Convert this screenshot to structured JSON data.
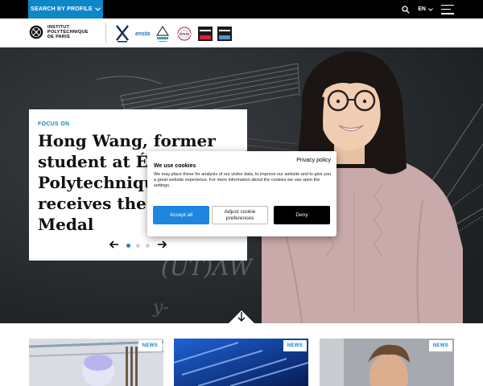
{
  "topbar": {
    "profile_label": "SEARCH BY PROFILE",
    "language": "EN"
  },
  "header": {
    "logo_lines": [
      "INSTITUT",
      "POLYTECHNIQUE",
      "DE PARIS"
    ],
    "partners": [
      "ÉCOLE POLYTECHNIQUE",
      "ENSTA",
      "PONTS",
      "ENSAE",
      "TÉLÉCOM PARIS",
      "TÉLÉCOM SUDPARIS"
    ]
  },
  "hero": {
    "focus_label": "FOCUS ON",
    "headline": "Hong Wang, former student at École Polytechnique, receives the Fields Medal",
    "chalk_text": "(UT)ΛW",
    "chalk_text_2": "y-"
  },
  "cookie": {
    "privacy_link": "Privacy policy",
    "title": "We use cookies",
    "text": "We may place these for analysis of our visitor data, to improve our website and to give you a great website experience. For more information about the cookies we use open the settings.",
    "accept_label": "Accept all",
    "adjust_label": "Adjust cookie preferences",
    "deny_label": "Deny"
  },
  "news": [
    {
      "tag": "NEWS"
    },
    {
      "tag": "NEWS"
    },
    {
      "tag": "NEWS"
    }
  ],
  "colors": {
    "accent": "#0e87c9",
    "accept": "#1e86df",
    "black": "#000000"
  }
}
